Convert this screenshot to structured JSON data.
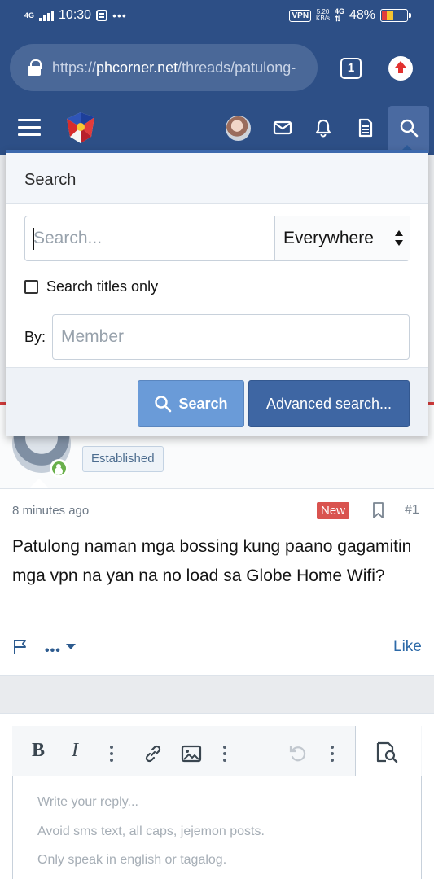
{
  "status_bar": {
    "network": "4G",
    "time": "10:30",
    "vpn_label": "VPN",
    "speed_value": "5.20",
    "speed_unit": "KB/s",
    "battery": "48%"
  },
  "browser": {
    "url_prefix": "https://",
    "url_host": "phcorner.net",
    "url_path": "/threads/patulong-",
    "tab_count": "1"
  },
  "search_menu": {
    "title": "Search",
    "search_placeholder": "Search...",
    "scope_value": "Everywhere",
    "titles_only_label": "Search titles only",
    "by_label": "By:",
    "member_placeholder": "Member",
    "search_button": "Search",
    "advanced_button": "Advanced search..."
  },
  "post": {
    "user_title": "Established",
    "time": "8 minutes ago",
    "new_badge": "New",
    "number": "#1",
    "text": "Patulong naman mga bossing kung paano gagamitin mga vpn na yan na no load sa Globe Home Wifi?",
    "like_label": "Like"
  },
  "editor": {
    "placeholder_lines": [
      "Write your reply...",
      "Avoid sms text, all caps, jejemon posts.",
      "Only speak in english or tagalog."
    ]
  },
  "colors": {
    "header_bg": "#2d4f86",
    "accent": "#3d69ad",
    "new_badge": "#d9534f",
    "online": "#6ab04c"
  }
}
